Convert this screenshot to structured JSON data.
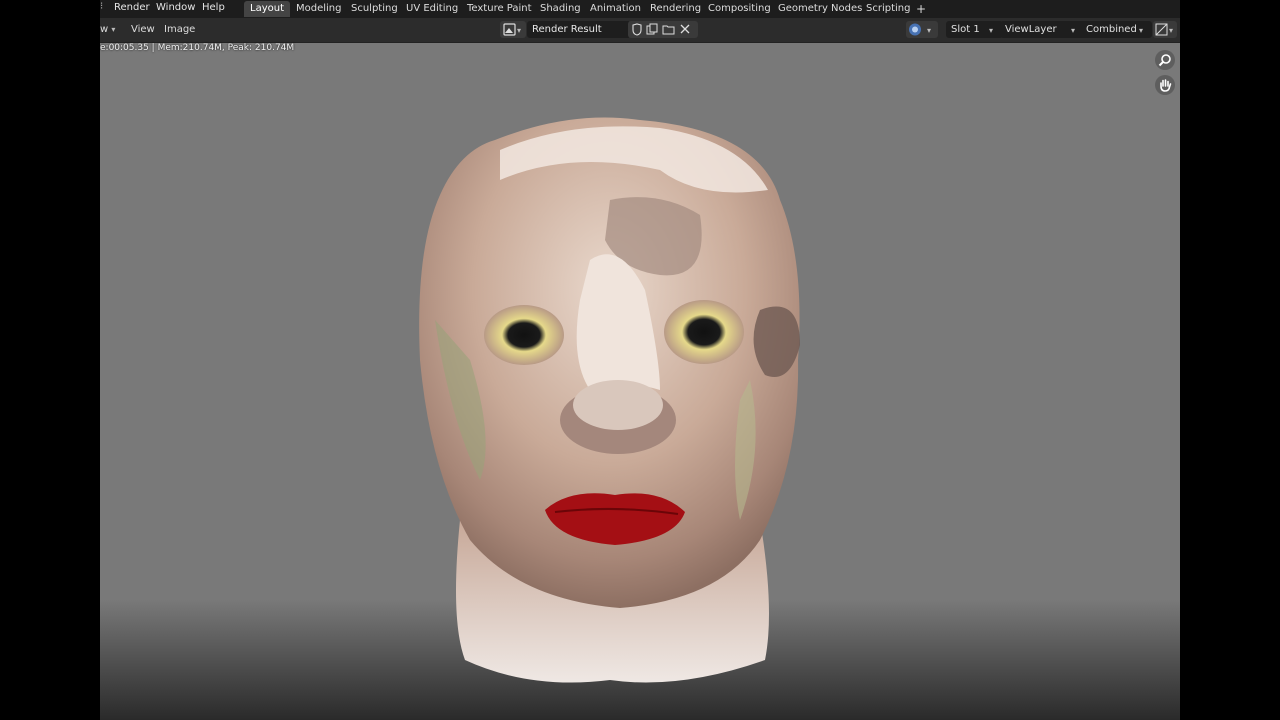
{
  "menubar": {
    "menus": [
      "Render",
      "Window",
      "Help"
    ],
    "workspaces": [
      "Layout",
      "Modeling",
      "Sculpting",
      "UV Editing",
      "Texture Paint",
      "Shading",
      "Animation",
      "Rendering",
      "Compositing",
      "Geometry Nodes",
      "Scripting"
    ],
    "active_workspace": "Layout",
    "add_workspace": "+"
  },
  "header": {
    "view_mode_partial": "w",
    "view_menu": "View",
    "image_menu": "Image",
    "image_name": "Render Result",
    "slot": "Slot 1",
    "view_layer": "ViewLayer",
    "pass": "Combined"
  },
  "status": {
    "text": "e:00:05.35 | Mem:210.74M, Peak: 210.74M"
  },
  "colors": {
    "accent": "#4772b3",
    "viewport_bg": "#797979",
    "topbar": "#1d1d1d",
    "header": "#2c2c2c"
  }
}
